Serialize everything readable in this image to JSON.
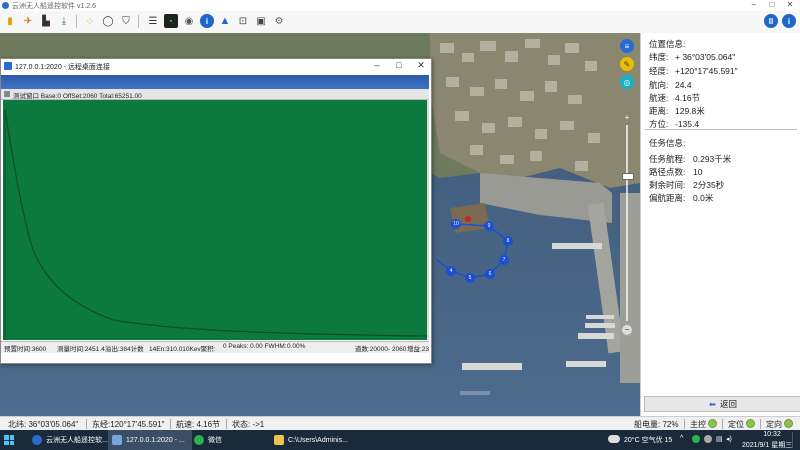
{
  "app": {
    "title": "云洲无人船遥控软件 v1.2.6",
    "help_label": "i",
    "pause_label": "II"
  },
  "position_info": {
    "header": "位置信息:",
    "fields": [
      {
        "label": "纬度:",
        "value": "+ 36°03'05.064\""
      },
      {
        "label": "经度:",
        "value": "+120°17'45.591\""
      },
      {
        "label": "航向:",
        "value": "24.4"
      },
      {
        "label": "航速:",
        "value": "4.16节"
      },
      {
        "label": "距离:",
        "value": "129.8米"
      },
      {
        "label": "方位:",
        "value": "-135.4"
      }
    ]
  },
  "task_info": {
    "header": "任务信息:",
    "fields": [
      {
        "label": "任务航程:",
        "value": "0.293千米"
      },
      {
        "label": "路径点数:",
        "value": "10"
      },
      {
        "label": "剩余时间:",
        "value": "2分35秒"
      },
      {
        "label": "偏航距离:",
        "value": "0.0米"
      }
    ]
  },
  "back_button": {
    "label": "返回"
  },
  "route_points": [
    "10",
    "9",
    "8",
    "7",
    "6",
    "5",
    "4"
  ],
  "remote_window": {
    "title": "127.0.0.1:2020 - 远程桌面连接",
    "subtitle": "测试窗口 Base:0 OffSet:2060 Total:65251.00",
    "status": {
      "preset": "预置时间:3600",
      "measure": "测量时间:2451.4",
      "rate": "溢出:384计数",
      "en": "14En:310.010Kev聚积:",
      "peaks": "0 Peaks: 0.00  FWHM:",
      "pct": "0.00%",
      "range": "道数:20000- 2060",
      "gain": "增益:23"
    }
  },
  "status_bar": {
    "lat": "北纬: 36°03'05.064\"",
    "lon": "东经:120°17'45.591\"",
    "speed": "航速: 4.16节",
    "state": "状态: ->1",
    "battery": "船电量: 72%",
    "master": "主控",
    "positioning": "定位",
    "heading": "定向"
  },
  "taskbar": {
    "items": [
      {
        "label": "云洲无人船遥控软..."
      },
      {
        "label": "127.0.0.1:2020 - ..."
      },
      {
        "label": "微信"
      },
      {
        "label": "C:\\Users\\Adminis..."
      }
    ],
    "weather": "20°C 空气优 15",
    "time": "10:32",
    "date": "2021/9/1 星期三"
  },
  "colors": {
    "plot_bg": "#0c7a3e",
    "route": "#1a4fd6",
    "window_band": "#2b5aa8",
    "taskbar": "#1a2a3a"
  }
}
